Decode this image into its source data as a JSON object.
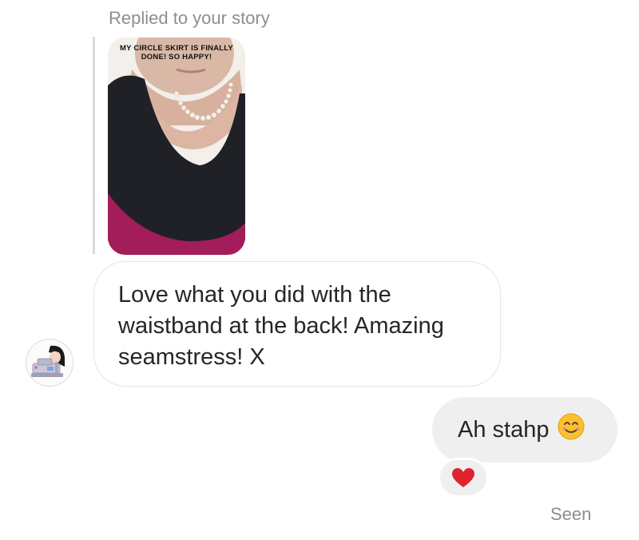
{
  "thread": {
    "replied_label": "Replied to your story",
    "story": {
      "caption_line1": "MY CIRCLE SKIRT IS FINALLY",
      "caption_line2": "DONE! SO HAPPY!"
    },
    "incoming": {
      "avatar_icon": "sewing-machine-avatar",
      "text": "Love what you did with the waistband at the back! Amazing seamstress! X"
    },
    "outgoing": {
      "text": "Ah stahp",
      "emoji": "smiling-face-emoji"
    },
    "reaction": {
      "icon": "red-heart-icon",
      "color": "#e0242f"
    },
    "status": "Seen"
  }
}
